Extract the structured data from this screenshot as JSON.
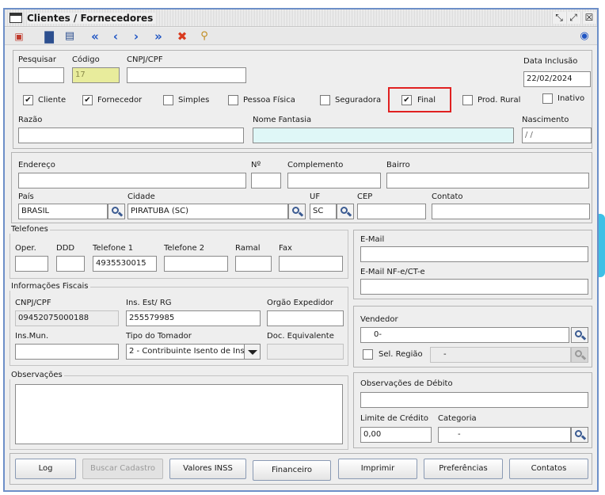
{
  "window": {
    "title": "Clientes / Fornecedores"
  },
  "toolbar": {
    "icons": [
      "close-form-icon",
      "save-icon",
      "document-icon",
      "first-record-icon",
      "previous-record-icon",
      "next-record-icon",
      "last-record-icon",
      "delete-icon",
      "search-icon",
      "help-icon"
    ]
  },
  "ident": {
    "pesquisar_label": "Pesquisar",
    "pesquisar_value": "",
    "codigo_label": "Código",
    "codigo_value": "17",
    "cnpj_label": "CNPJ/CPF",
    "cnpj_value": "",
    "data_label": "Data Inclusão",
    "data_value": "22/02/2024",
    "checks": [
      {
        "label": "Cliente",
        "checked": true
      },
      {
        "label": "Fornecedor",
        "checked": true
      },
      {
        "label": "Simples",
        "checked": false
      },
      {
        "label": "Pessoa Física",
        "checked": false
      },
      {
        "label": "Seguradora",
        "checked": false
      },
      {
        "label": "Final",
        "checked": true
      },
      {
        "label": "Prod. Rural",
        "checked": false
      },
      {
        "label": "Inativo",
        "checked": false
      }
    ],
    "razao_label": "Razão",
    "razao_value": "",
    "fantasia_label": "Nome Fantasia",
    "fantasia_value": "",
    "nasc_label": "Nascimento",
    "nasc_value": " / /"
  },
  "endereco": {
    "endereco_label": "Endereço",
    "endereco_value": "",
    "numero_label": "Nº",
    "numero_value": "",
    "complemento_label": "Complemento",
    "complemento_value": "",
    "bairro_label": "Bairro",
    "bairro_value": "",
    "pais_label": "País",
    "pais_value": "BRASIL",
    "cidade_label": "Cidade",
    "cidade_value": "PIRATUBA (SC)",
    "uf_label": "UF",
    "uf_value": "SC",
    "cep_label": "CEP",
    "cep_value": "",
    "contato_label": "Contato",
    "contato_value": ""
  },
  "telefones": {
    "legend": "Telefones",
    "oper_label": "Oper.",
    "oper_value": "",
    "ddd_label": "DDD",
    "ddd_value": "",
    "tel1_label": "Telefone 1",
    "tel1_value": "4935530015",
    "tel2_label": "Telefone 2",
    "tel2_value": "",
    "ramal_label": "Ramal",
    "ramal_value": "",
    "fax_label": "Fax",
    "fax_value": ""
  },
  "email": {
    "email_label": "E-Mail",
    "email_value": "",
    "nfe_label": "E-Mail  NF-e/CT-e",
    "nfe_value": ""
  },
  "fiscais": {
    "legend": "Informações Fiscais",
    "cnpj_label": "CNPJ/CPF",
    "cnpj_value": "09452075000188",
    "ie_label": "Ins. Est/ RG",
    "ie_value": "255579985",
    "orgao_label": "Orgão Expedidor",
    "orgao_value": "",
    "insmun_label": "Ins.Mun.",
    "insmun_value": "",
    "tomador_label": "Tipo do Tomador",
    "tomador_value": "2 - Contribuinte Isento de Ins...",
    "docequiv_label": "Doc. Equivalente",
    "docequiv_value": ""
  },
  "vendedor": {
    "label": "Vendedor",
    "value": "0-",
    "sel_regiao_label": "Sel. Região",
    "sel_regiao_checked": false,
    "regiao_value": "-"
  },
  "observacoes": {
    "legend": "Observações",
    "value": ""
  },
  "debito": {
    "obs_label": "Observações de Débito",
    "obs_value": "",
    "limite_label": "Limite de Crédito",
    "limite_value": "0,00",
    "categoria_label": "Categoria",
    "categoria_value": "-"
  },
  "buttons": {
    "log": "Log",
    "buscar": "Buscar Cadastro",
    "inss": "Valores INSS",
    "financeiro": "Financeiro",
    "imprimir": "Imprimir",
    "preferencias": "Preferências",
    "contatos": "Contatos"
  },
  "colors": {
    "window_border": "#6d8fc8",
    "highlight": "#e02020",
    "codigo_bg": "#e8ec9c",
    "fantasia_bg": "#dff7f7",
    "edge_accent": "#3ec0e6"
  }
}
